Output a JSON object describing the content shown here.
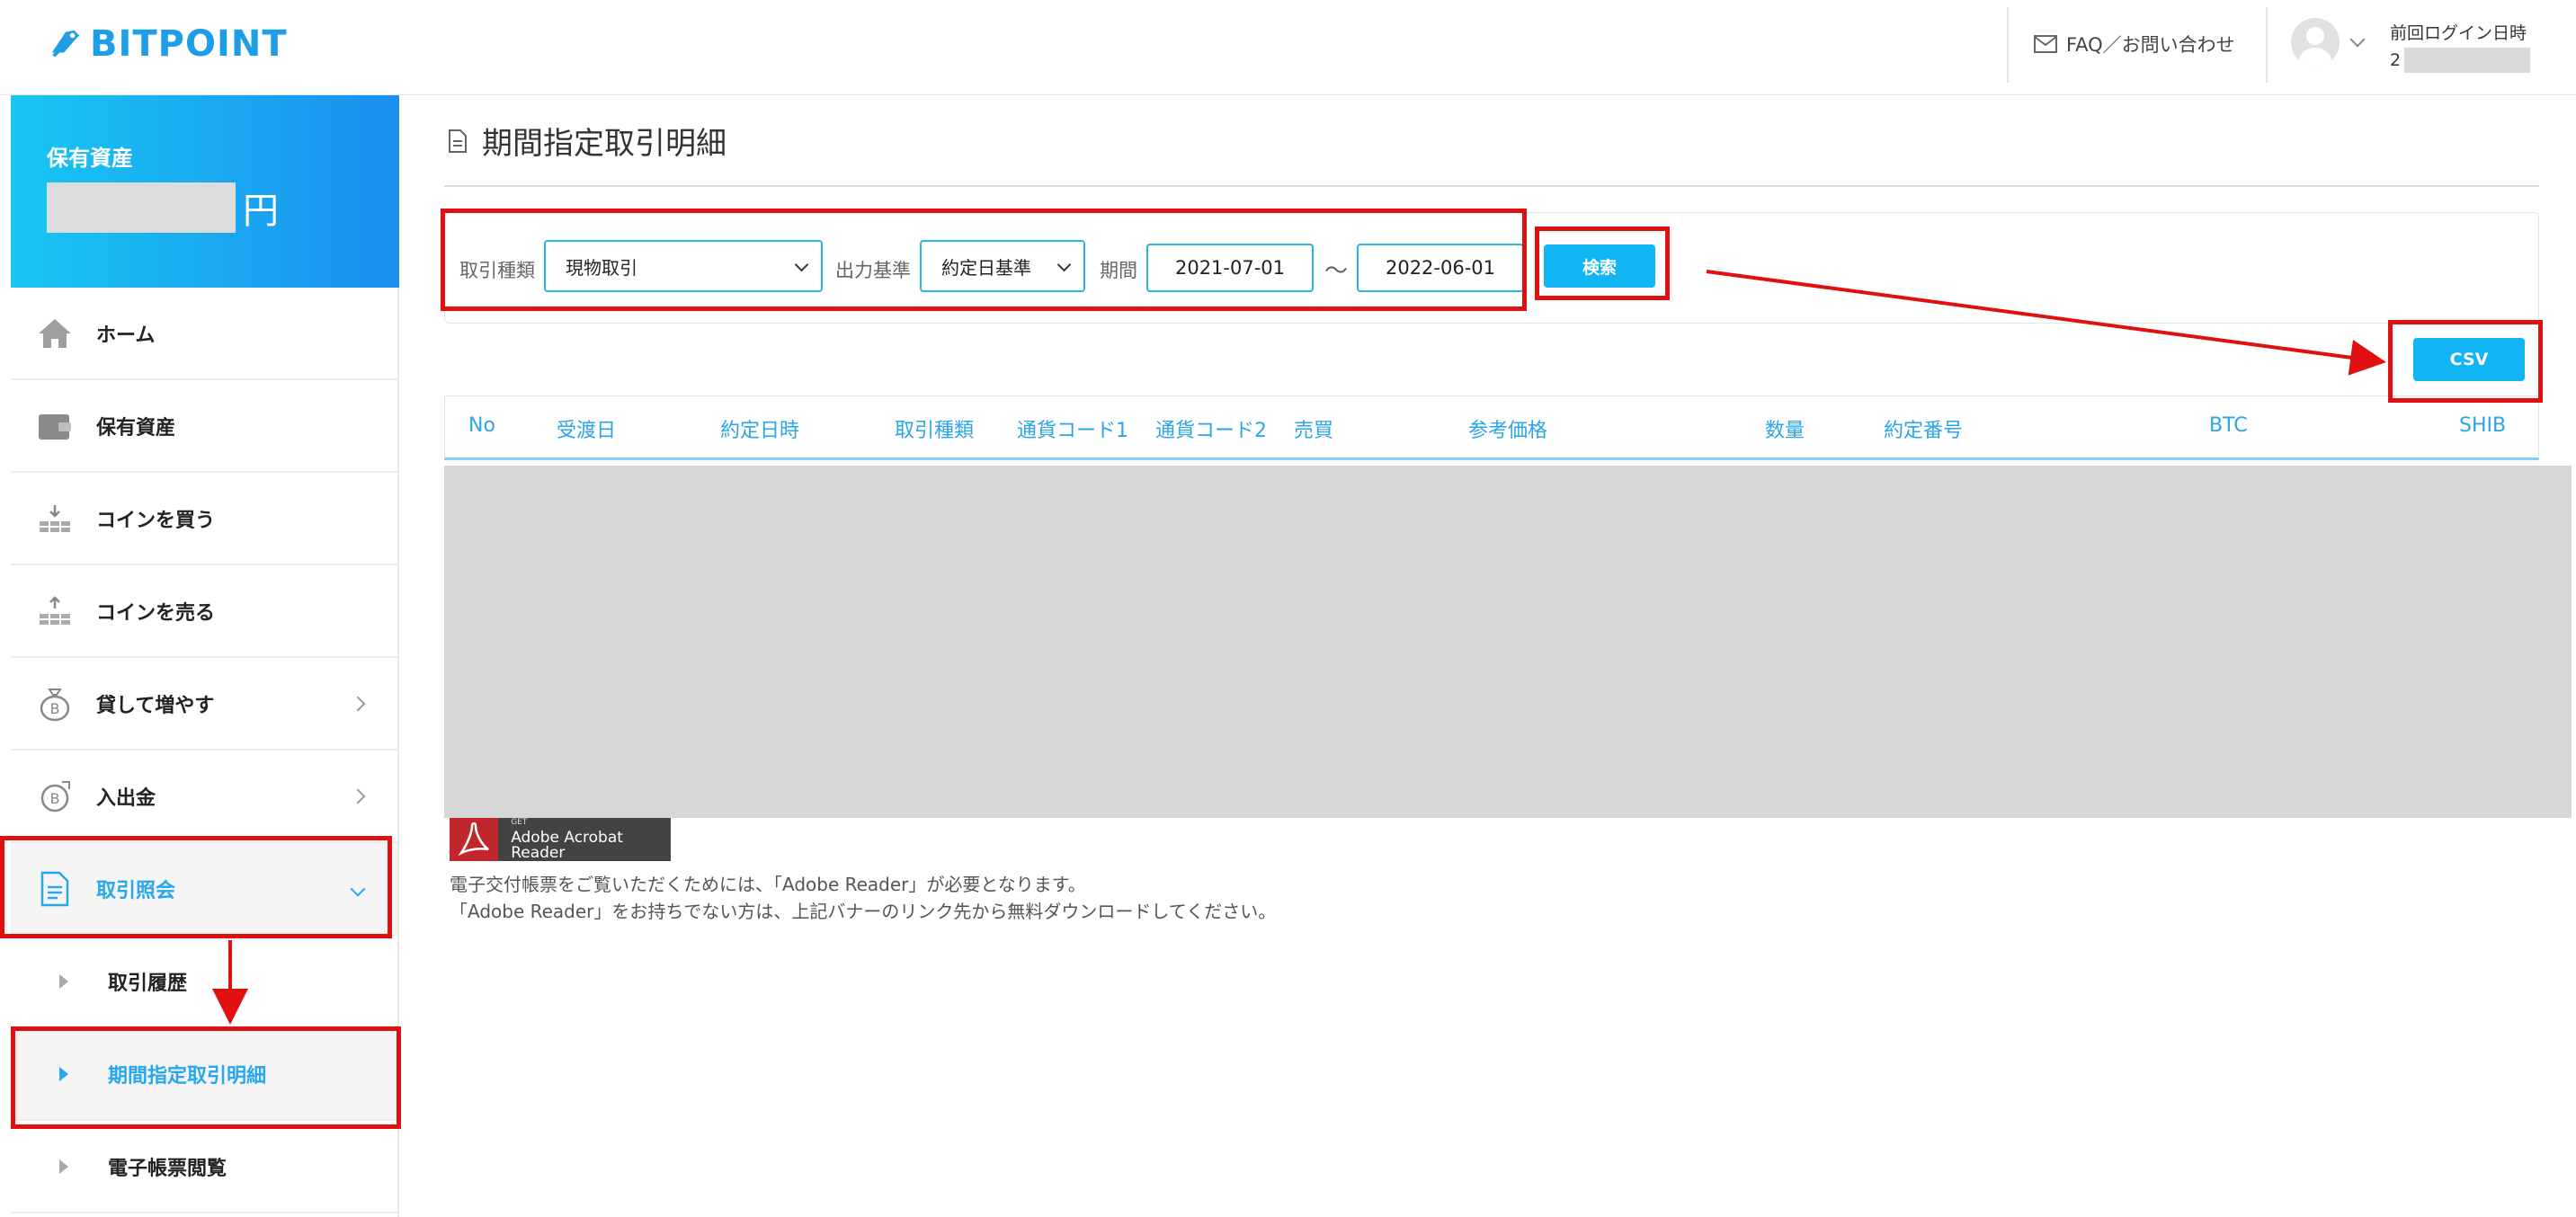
{
  "brand": {
    "name": "BITPOINT",
    "color": "#1e9ee6"
  },
  "header": {
    "faq_label": "FAQ／お問い合わせ",
    "last_login_label": "前回ログイン日時",
    "last_login_value_prefix": "2"
  },
  "sidebar": {
    "assets_label": "保有資産",
    "assets_unit": "円",
    "items": [
      {
        "label": "ホーム",
        "icon": "home-icon"
      },
      {
        "label": "保有資産",
        "icon": "wallet-icon"
      },
      {
        "label": "コインを買う",
        "icon": "buy-coins-icon"
      },
      {
        "label": "コインを売る",
        "icon": "sell-coins-icon"
      },
      {
        "label": "貸して増やす",
        "icon": "money-bag-icon"
      },
      {
        "label": "入出金",
        "icon": "bitcoin-transfer-icon"
      },
      {
        "label": "取引照会",
        "icon": "document-icon"
      }
    ],
    "sub_items": [
      {
        "label": "取引履歴"
      },
      {
        "label": "期間指定取引明細"
      },
      {
        "label": "電子帳票閲覧"
      }
    ]
  },
  "page": {
    "title": "期間指定取引明細"
  },
  "filter": {
    "trade_type_label": "取引種類",
    "trade_type_value": "現物取引",
    "output_basis_label": "出力基準",
    "output_basis_value": "約定日基準",
    "period_label": "期間",
    "date_from": "2021-07-01",
    "tilde": "～",
    "date_to": "2022-06-01",
    "search_label": "検索",
    "csv_label": "CSV"
  },
  "table": {
    "headers": [
      "No",
      "受渡日",
      "約定日時",
      "取引種類",
      "通貨コード1",
      "通貨コード2",
      "売買",
      "参考価格",
      "数量",
      "約定番号",
      "BTC",
      "SHIB"
    ]
  },
  "adobe": {
    "get": "GET",
    "name": "Adobe Acrobat Reader",
    "note1": "電子交付帳票をご覧いただくためには、「Adobe Reader」が必要となります。",
    "note2": "「Adobe Reader」をお持ちでない方は、上記バナーのリンク先から無料ダウンロードしてください。"
  },
  "colors": {
    "accent": "#11b5f3",
    "annotation": "#e01010",
    "mask": "#d7d7d7"
  }
}
